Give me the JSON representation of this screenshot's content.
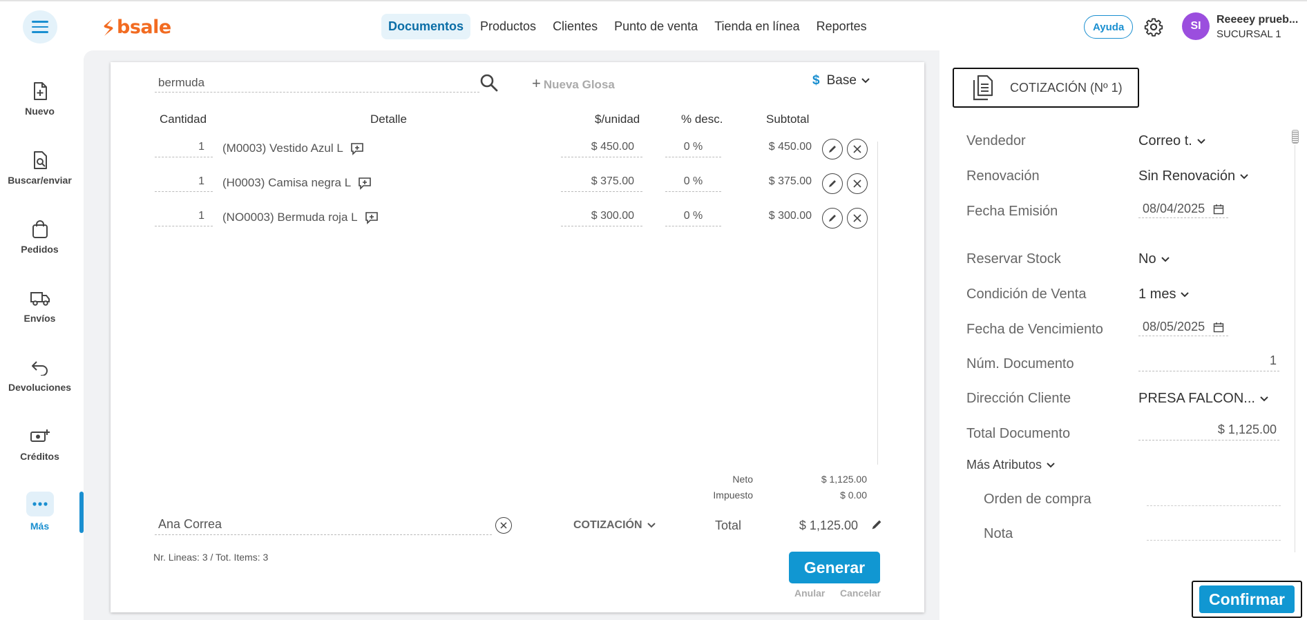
{
  "topbar": {
    "logo_text": "bsale",
    "nav": [
      "Documentos",
      "Productos",
      "Clientes",
      "Punto de venta",
      "Tienda en línea",
      "Reportes"
    ],
    "help_label": "Ayuda",
    "avatar_initials": "SI",
    "user_name": "Reeeey prueb...",
    "user_branch": "SUCURSAL 1"
  },
  "sidebar": {
    "items": [
      {
        "label": "Nuevo",
        "icon": "new-document-icon"
      },
      {
        "label": "Buscar/enviar",
        "icon": "search-document-icon"
      },
      {
        "label": "Pedidos",
        "icon": "shopping-bag-icon"
      },
      {
        "label": "Envíos",
        "icon": "truck-icon"
      },
      {
        "label": "Devoluciones",
        "icon": "return-arrow-icon"
      },
      {
        "label": "Créditos",
        "icon": "money-plus-icon"
      },
      {
        "label": "Más",
        "icon": "more-dots-icon"
      }
    ],
    "active": "Más"
  },
  "document": {
    "search_value": "bermuda",
    "nueva_glosa": "Nueva Glosa",
    "price_list": "Base",
    "currency_symbol": "$",
    "headers": {
      "cantidad": "Cantidad",
      "detalle": "Detalle",
      "unidad": "$/unidad",
      "desc": "% desc.",
      "subtotal": "Subtotal"
    },
    "rows": [
      {
        "qty": "1",
        "detail": "(M0003) Vestido Azul L",
        "price": "$ 450.00",
        "disc": "0 %",
        "subtotal": "$ 450.00"
      },
      {
        "qty": "1",
        "detail": "(H0003) Camisa negra L",
        "price": "$ 375.00",
        "disc": "0 %",
        "subtotal": "$ 375.00"
      },
      {
        "qty": "1",
        "detail": "(NO0003) Bermuda roja L",
        "price": "$ 300.00",
        "disc": "0 %",
        "subtotal": "$ 300.00"
      }
    ],
    "neto_label": "Neto",
    "neto_value": "$ 1,125.00",
    "impuesto_label": "Impuesto",
    "impuesto_value": "$ 0.00",
    "client": "Ana Correa",
    "doc_type": "COTIZACIÓN",
    "total_label": "Total",
    "total_value": "$ 1,125.00",
    "lines_info": "Nr. Lineas: 3 / Tot. Items: 3",
    "generar": "Generar",
    "anular": "Anular",
    "cancelar": "Cancelar"
  },
  "panel": {
    "doc_title": "COTIZACIÓN (Nº 1)",
    "vendedor_label": "Vendedor",
    "vendedor_value": "Correo t.",
    "renovacion_label": "Renovación",
    "renovacion_value": "Sin Renovación",
    "fecha_emision_label": "Fecha Emisión",
    "fecha_emision_value": "08/04/2025",
    "reservar_label": "Reservar Stock",
    "reservar_value": "No",
    "condicion_label": "Condición de Venta",
    "condicion_value": "1 mes",
    "vencimiento_label": "Fecha de Vencimiento",
    "vencimiento_value": "08/05/2025",
    "num_doc_label": "Núm. Documento",
    "num_doc_value": "1",
    "direccion_label": "Dirección Cliente",
    "direccion_value": "PRESA FALCON...",
    "total_doc_label": "Total Documento",
    "total_doc_value": "$ 1,125.00",
    "mas_atributos": "Más Atributos",
    "orden_label": "Orden de compra",
    "nota_label": "Nota",
    "confirmar": "Confirmar"
  },
  "colors": {
    "accent": "#1197d2",
    "brand": "#f26b21",
    "avatar": "#9b4ede"
  }
}
